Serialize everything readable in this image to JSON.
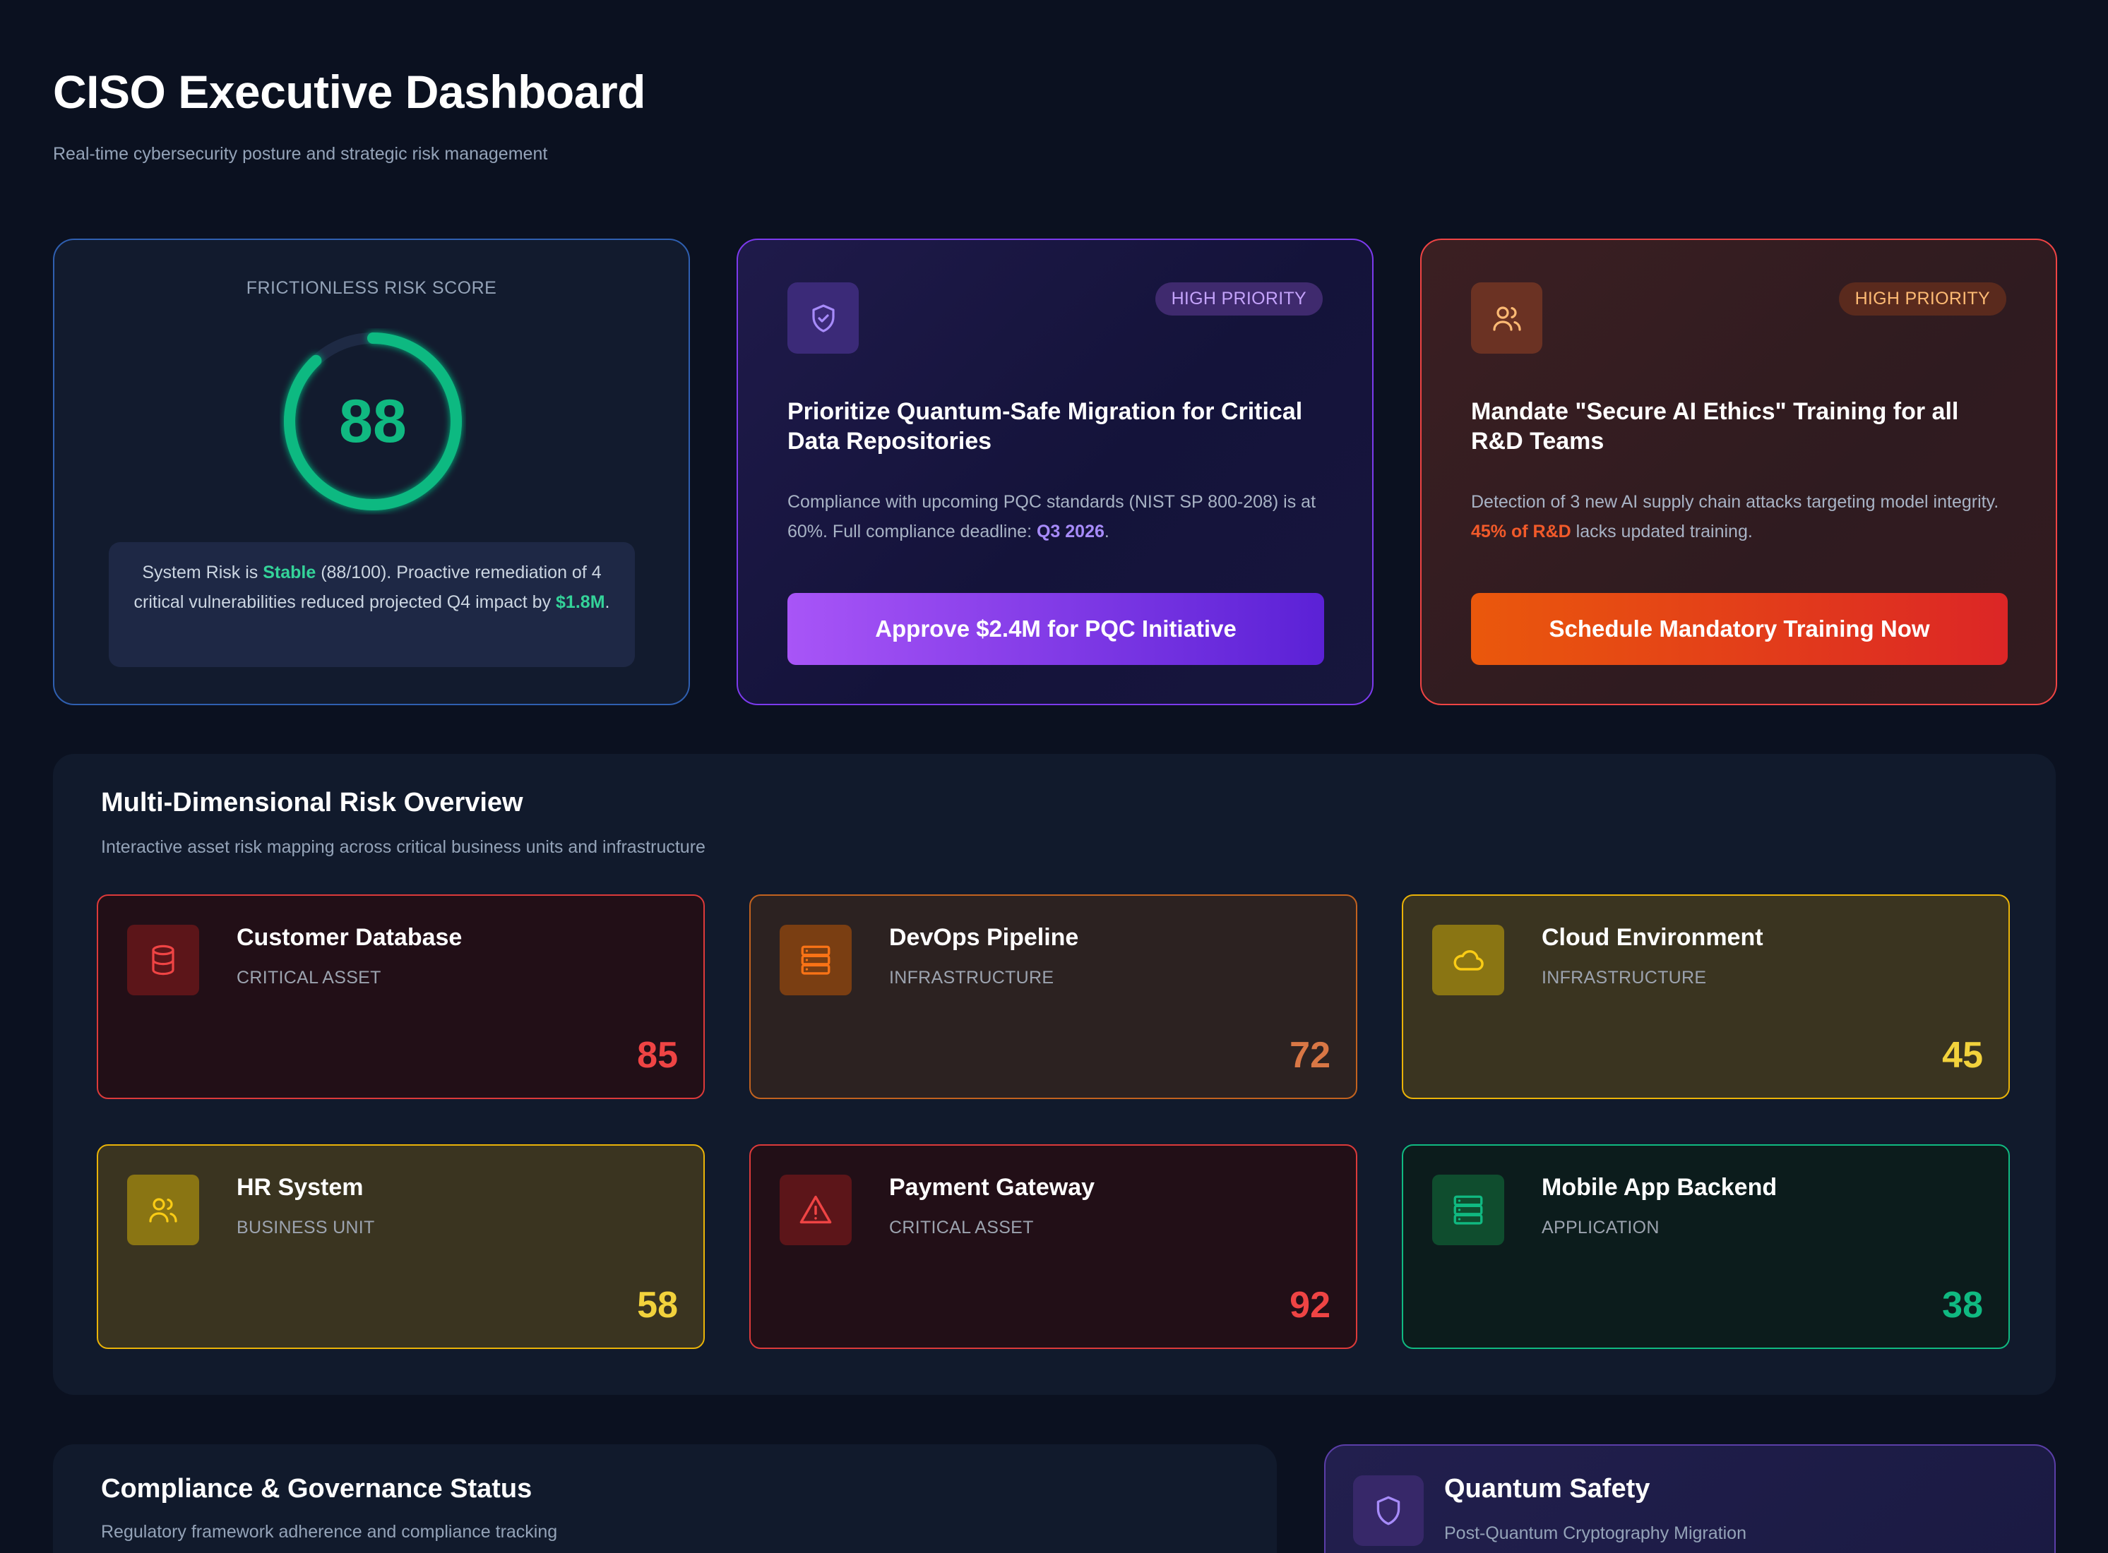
{
  "header": {
    "title": "CISO Executive Dashboard",
    "subtitle": "Real-time cybersecurity posture and strategic risk management"
  },
  "risk_score": {
    "label": "FRICTIONLESS RISK SCORE",
    "value": "88",
    "gauge_fraction": 0.88,
    "note_prefix": "System Risk is ",
    "note_status": "Stable",
    "note_middle": " (88/100). Proactive remediation of 4 critical vulnerabilities reduced projected Q4 impact by ",
    "note_amount": "$1.8M",
    "note_suffix": "."
  },
  "recommendations": [
    {
      "icon": "shield-check-icon",
      "badge": "HIGH PRIORITY",
      "title": "Prioritize Quantum-Safe Migration for Critical Data Repositories",
      "desc_prefix": "Compliance with upcoming PQC standards (NIST SP 800-208) is at 60%. Full compliance deadline: ",
      "desc_highlight": "Q3 2026",
      "desc_suffix": ".",
      "button": "Approve $2.4M for PQC Initiative"
    },
    {
      "icon": "users-icon",
      "badge": "HIGH PRIORITY",
      "title": "Mandate \"Secure AI Ethics\" Training for all R&D Teams",
      "desc_prefix": "Detection of 3 new AI supply chain attacks targeting model integrity. ",
      "desc_highlight": "45% of R&D",
      "desc_suffix": " lacks updated training.",
      "button": "Schedule Mandatory Training Now"
    }
  ],
  "overview": {
    "title": "Multi-Dimensional Risk Overview",
    "subtitle": "Interactive asset risk mapping across critical business units and infrastructure",
    "assets": [
      {
        "name": "Customer Database",
        "category": "CRITICAL ASSET",
        "score": "85",
        "icon": "database-icon",
        "level": "red"
      },
      {
        "name": "DevOps Pipeline",
        "category": "INFRASTRUCTURE",
        "score": "72",
        "icon": "server-icon",
        "level": "orange"
      },
      {
        "name": "Cloud Environment",
        "category": "INFRASTRUCTURE",
        "score": "45",
        "icon": "cloud-icon",
        "level": "yellow"
      },
      {
        "name": "HR System",
        "category": "BUSINESS UNIT",
        "score": "58",
        "icon": "users-icon",
        "level": "yellow"
      },
      {
        "name": "Payment Gateway",
        "category": "CRITICAL ASSET",
        "score": "92",
        "icon": "alert-triangle-icon",
        "level": "red"
      },
      {
        "name": "Mobile App Backend",
        "category": "APPLICATION",
        "score": "38",
        "icon": "server-icon",
        "level": "green"
      }
    ]
  },
  "compliance": {
    "title": "Compliance & Governance Status",
    "subtitle": "Regulatory framework adherence and compliance tracking"
  },
  "quantum_safety": {
    "icon": "shield-icon",
    "title": "Quantum Safety",
    "subtitle": "Post-Quantum Cryptography Migration"
  },
  "colors": {
    "background": "#0b1120",
    "green": "#10b981",
    "purple": "#7c3aed",
    "orange": "#ea580c",
    "red": "#ef4444",
    "yellow": "#eab308"
  }
}
